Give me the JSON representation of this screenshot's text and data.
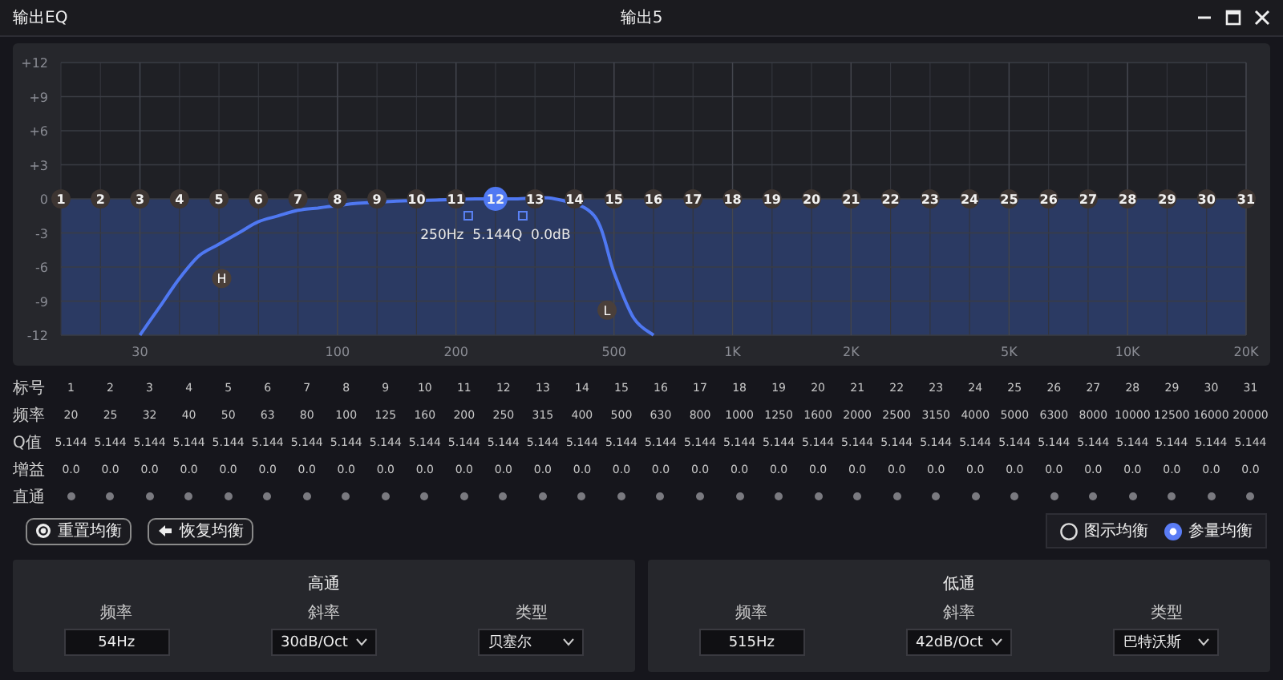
{
  "window": {
    "title": "输出EQ",
    "subtitle": "输出5"
  },
  "graph": {
    "chart_data": {
      "type": "line",
      "grid": true,
      "ylim": [
        -12,
        12
      ],
      "categories": [
        null,
        null,
        null,
        null,
        "30",
        null,
        null,
        null,
        null,
        null,
        null,
        null,
        null,
        null,
        "100",
        null,
        null,
        null,
        null,
        null,
        "200",
        null,
        null,
        null,
        null,
        null,
        null,
        null,
        "500",
        null,
        null,
        null,
        null,
        null,
        "1K",
        null,
        null,
        null,
        null,
        null,
        "2K",
        null,
        null,
        null,
        null,
        null,
        null,
        null,
        "5K",
        null,
        null,
        null,
        null,
        null,
        "10K",
        null,
        null,
        null,
        null,
        null,
        "20K"
      ],
      "yticks": [
        {
          "value": 12,
          "label": "+12"
        },
        {
          "value": 9,
          "label": "+9"
        },
        {
          "value": 6,
          "label": "+6"
        },
        {
          "value": 3,
          "label": "+3"
        },
        {
          "value": 0,
          "label": "0"
        },
        {
          "value": -3,
          "label": "-3"
        },
        {
          "value": -6,
          "label": "-6"
        },
        {
          "value": -9,
          "label": "-9"
        },
        {
          "value": -12,
          "label": "-12"
        }
      ],
      "series": [
        {
          "color": "#4f78f2",
          "values": [
            null,
            null,
            null,
            null,
            -12,
            -9.5,
            -7,
            -5,
            -4,
            -3,
            -2,
            -1.5,
            -1,
            -0.8,
            -0.6,
            -0.4,
            null,
            -0.2,
            null,
            -0.1,
            null,
            0,
            null,
            0,
            null,
            0,
            null,
            -1.5,
            -6.5,
            -10.5,
            -12,
            null,
            null,
            null,
            null,
            null,
            null,
            null,
            null,
            null,
            null,
            null,
            null,
            null,
            null,
            null,
            null,
            null,
            null,
            null,
            null,
            null,
            null,
            null,
            null,
            null,
            null,
            null,
            null,
            null,
            null
          ]
        }
      ]
    },
    "bands": [
      {
        "label": "1",
        "selected": false
      },
      {
        "label": "2",
        "selected": false
      },
      {
        "label": "3",
        "selected": false
      },
      {
        "label": "4",
        "selected": false
      },
      {
        "label": "5",
        "selected": false
      },
      {
        "label": "6",
        "selected": false
      },
      {
        "label": "7",
        "selected": false
      },
      {
        "label": "8",
        "selected": false
      },
      {
        "label": "9",
        "selected": false
      },
      {
        "label": "10",
        "selected": false
      },
      {
        "label": "11",
        "selected": false
      },
      {
        "label": "12",
        "selected": true
      },
      {
        "label": "13",
        "selected": false
      },
      {
        "label": "14",
        "selected": false
      },
      {
        "label": "15",
        "selected": false
      },
      {
        "label": "16",
        "selected": false
      },
      {
        "label": "17",
        "selected": false
      },
      {
        "label": "18",
        "selected": false
      },
      {
        "label": "19",
        "selected": false
      },
      {
        "label": "20",
        "selected": false
      },
      {
        "label": "21",
        "selected": false
      },
      {
        "label": "22",
        "selected": false
      },
      {
        "label": "23",
        "selected": false
      },
      {
        "label": "24",
        "selected": false
      },
      {
        "label": "25",
        "selected": false
      },
      {
        "label": "26",
        "selected": false
      },
      {
        "label": "27",
        "selected": false
      },
      {
        "label": "28",
        "selected": false
      },
      {
        "label": "29",
        "selected": false
      },
      {
        "label": "30",
        "selected": false
      },
      {
        "label": "31",
        "selected": false
      }
    ],
    "readout": "250Hz  5.144Q  0.0dB",
    "filter_handles": [
      {
        "kind": "highpass",
        "label": "H"
      },
      {
        "kind": "lowpass",
        "label": "L"
      }
    ]
  },
  "table": {
    "row_labels": [
      "标号",
      "频率",
      "Q值",
      "增益",
      "直通"
    ],
    "bands": [
      {
        "number": "1",
        "freq": "20",
        "q": "5.144",
        "gain": "0.0",
        "bypass": false
      },
      {
        "number": "2",
        "freq": "25",
        "q": "5.144",
        "gain": "0.0",
        "bypass": false
      },
      {
        "number": "3",
        "freq": "32",
        "q": "5.144",
        "gain": "0.0",
        "bypass": false
      },
      {
        "number": "4",
        "freq": "40",
        "q": "5.144",
        "gain": "0.0",
        "bypass": false
      },
      {
        "number": "5",
        "freq": "50",
        "q": "5.144",
        "gain": "0.0",
        "bypass": false
      },
      {
        "number": "6",
        "freq": "63",
        "q": "5.144",
        "gain": "0.0",
        "bypass": false
      },
      {
        "number": "7",
        "freq": "80",
        "q": "5.144",
        "gain": "0.0",
        "bypass": false
      },
      {
        "number": "8",
        "freq": "100",
        "q": "5.144",
        "gain": "0.0",
        "bypass": false
      },
      {
        "number": "9",
        "freq": "125",
        "q": "5.144",
        "gain": "0.0",
        "bypass": false
      },
      {
        "number": "10",
        "freq": "160",
        "q": "5.144",
        "gain": "0.0",
        "bypass": false
      },
      {
        "number": "11",
        "freq": "200",
        "q": "5.144",
        "gain": "0.0",
        "bypass": false
      },
      {
        "number": "12",
        "freq": "250",
        "q": "5.144",
        "gain": "0.0",
        "bypass": false
      },
      {
        "number": "13",
        "freq": "315",
        "q": "5.144",
        "gain": "0.0",
        "bypass": false
      },
      {
        "number": "14",
        "freq": "400",
        "q": "5.144",
        "gain": "0.0",
        "bypass": false
      },
      {
        "number": "15",
        "freq": "500",
        "q": "5.144",
        "gain": "0.0",
        "bypass": false
      },
      {
        "number": "16",
        "freq": "630",
        "q": "5.144",
        "gain": "0.0",
        "bypass": false
      },
      {
        "number": "17",
        "freq": "800",
        "q": "5.144",
        "gain": "0.0",
        "bypass": false
      },
      {
        "number": "18",
        "freq": "1000",
        "q": "5.144",
        "gain": "0.0",
        "bypass": false
      },
      {
        "number": "19",
        "freq": "1250",
        "q": "5.144",
        "gain": "0.0",
        "bypass": false
      },
      {
        "number": "20",
        "freq": "1600",
        "q": "5.144",
        "gain": "0.0",
        "bypass": false
      },
      {
        "number": "21",
        "freq": "2000",
        "q": "5.144",
        "gain": "0.0",
        "bypass": false
      },
      {
        "number": "22",
        "freq": "2500",
        "q": "5.144",
        "gain": "0.0",
        "bypass": false
      },
      {
        "number": "23",
        "freq": "3150",
        "q": "5.144",
        "gain": "0.0",
        "bypass": false
      },
      {
        "number": "24",
        "freq": "4000",
        "q": "5.144",
        "gain": "0.0",
        "bypass": false
      },
      {
        "number": "25",
        "freq": "5000",
        "q": "5.144",
        "gain": "0.0",
        "bypass": false
      },
      {
        "number": "26",
        "freq": "6300",
        "q": "5.144",
        "gain": "0.0",
        "bypass": false
      },
      {
        "number": "27",
        "freq": "8000",
        "q": "5.144",
        "gain": "0.0",
        "bypass": false
      },
      {
        "number": "28",
        "freq": "10000",
        "q": "5.144",
        "gain": "0.0",
        "bypass": false
      },
      {
        "number": "29",
        "freq": "12500",
        "q": "5.144",
        "gain": "0.0",
        "bypass": false
      },
      {
        "number": "30",
        "freq": "16000",
        "q": "5.144",
        "gain": "0.0",
        "bypass": false
      },
      {
        "number": "31",
        "freq": "20000",
        "q": "5.144",
        "gain": "0.0",
        "bypass": false
      }
    ]
  },
  "buttons": [
    {
      "kind": "reset",
      "label": "重置均衡"
    },
    {
      "kind": "restore",
      "label": "恢复均衡"
    }
  ],
  "modes": [
    {
      "label": "图示均衡",
      "selected": false
    },
    {
      "label": "参量均衡",
      "selected": true
    }
  ],
  "filters": [
    {
      "title": "高通",
      "fields": [
        {
          "kind": "input",
          "label": "频率",
          "value": "54Hz"
        },
        {
          "kind": "select",
          "label": "斜率",
          "value": "30dB/Oct"
        },
        {
          "kind": "select",
          "label": "类型",
          "value": "贝塞尔"
        }
      ]
    },
    {
      "title": "低通",
      "fields": [
        {
          "kind": "input",
          "label": "频率",
          "value": "515Hz"
        },
        {
          "kind": "select",
          "label": "斜率",
          "value": "42dB/Oct"
        },
        {
          "kind": "select",
          "label": "类型",
          "value": "巴特沃斯"
        }
      ]
    }
  ]
}
